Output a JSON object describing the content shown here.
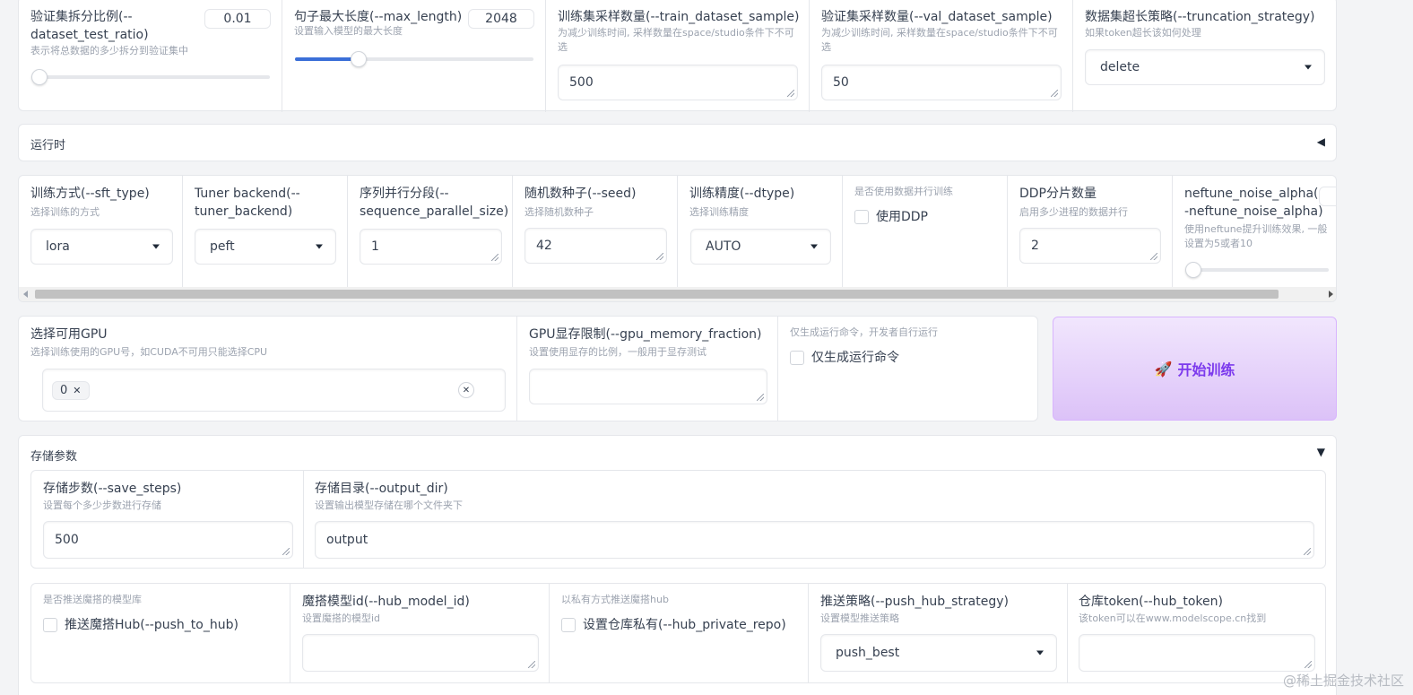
{
  "row1": {
    "test_ratio": {
      "label": "验证集拆分比例(--dataset_test_ratio)",
      "info": "表示将总数据的多少拆分到验证集中",
      "value": "0.01",
      "slider_fraction": 0.0
    },
    "max_length": {
      "label": "句子最大长度(--max_length)",
      "info": "设置输入模型的最大长度",
      "value": "2048",
      "slider_fraction": 0.25
    },
    "train_sample": {
      "label": "训练集采样数量(--train_dataset_sample)",
      "info": "为减少训练时间, 采样数量在space/studio条件下不可选",
      "value": "500"
    },
    "val_sample": {
      "label": "验证集采样数量(--val_dataset_sample)",
      "info": "为减少训练时间, 采样数量在space/studio条件下不可选",
      "value": "50"
    },
    "truncation": {
      "label": "数据集超长策略(--truncation_strategy)",
      "info": "如果token超长该如何处理",
      "value": "delete"
    }
  },
  "runtime": {
    "title": "运行时",
    "toggle": "◀"
  },
  "row2": {
    "sft_type": {
      "label": "训练方式(--sft_type)",
      "info": "选择训练的方式",
      "value": "lora"
    },
    "tuner_backend": {
      "label": "Tuner backend(--tuner_backend)",
      "value": "peft"
    },
    "seq_parallel": {
      "label": "序列并行分段(--sequence_parallel_size)",
      "value": "1"
    },
    "seed": {
      "label": "随机数种子(--seed)",
      "info": "选择随机数种子",
      "value": "42"
    },
    "dtype": {
      "label": "训练精度(--dtype)",
      "info": "选择训练精度",
      "value": "AUTO"
    },
    "ddp": {
      "info": "是否使用数据并行训练",
      "checkbox_label": "使用DDP"
    },
    "ddp_num": {
      "label": "DDP分片数量",
      "info": "启用多少进程的数据并行",
      "value": "2"
    },
    "neftune": {
      "label": "neftune_noise_alpha(--neftune_noise_alpha)",
      "info": "使用neftune提升训练效果, 一般设置为5或者10",
      "slider_fraction": 0.0
    }
  },
  "row3": {
    "gpu": {
      "label": "选择可用GPU",
      "info": "选择训练使用的GPU号，如CUDA不可用只能选择CPU",
      "token": "0"
    },
    "gpu_mem": {
      "label": "GPU显存限制(--gpu_memory_fraction)",
      "info": "设置使用显存的比例，一般用于显存测试",
      "value": ""
    },
    "dry_run": {
      "info": "仅生成运行命令，开发者自行运行",
      "checkbox_label": "仅生成运行命令"
    },
    "start_button": {
      "icon": "🚀",
      "label": "开始训练"
    }
  },
  "save": {
    "title": "存储参数",
    "toggle": "▼",
    "save_steps": {
      "label": "存储步数(--save_steps)",
      "info": "设置每个多少步数进行存储",
      "value": "500"
    },
    "output_dir": {
      "label": "存储目录(--output_dir)",
      "info": "设置输出模型存储在哪个文件夹下",
      "value": "output"
    },
    "push_to_hub": {
      "info": "是否推送魔搭的模型库",
      "checkbox_label": "推送魔搭Hub(--push_to_hub)"
    },
    "hub_model_id": {
      "label": "魔搭模型id(--hub_model_id)",
      "info": "设置魔搭的模型id",
      "value": ""
    },
    "hub_private": {
      "info": "以私有方式推送魔搭hub",
      "checkbox_label": "设置仓库私有(--hub_private_repo)"
    },
    "push_strategy": {
      "label": "推送策略(--push_hub_strategy)",
      "info": "设置模型推送策略",
      "value": "push_best"
    },
    "hub_token": {
      "label": "仓库token(--hub_token)",
      "info": "该token可以在www.modelscope.cn找到",
      "value": ""
    }
  },
  "watermark": "@稀土掘金技术社区",
  "colors": {
    "accent": "#3b6fd8",
    "button_text": "#7c3aed",
    "button_bg_from": "#f1e6fd",
    "button_bg_to": "#dcc2f8"
  }
}
